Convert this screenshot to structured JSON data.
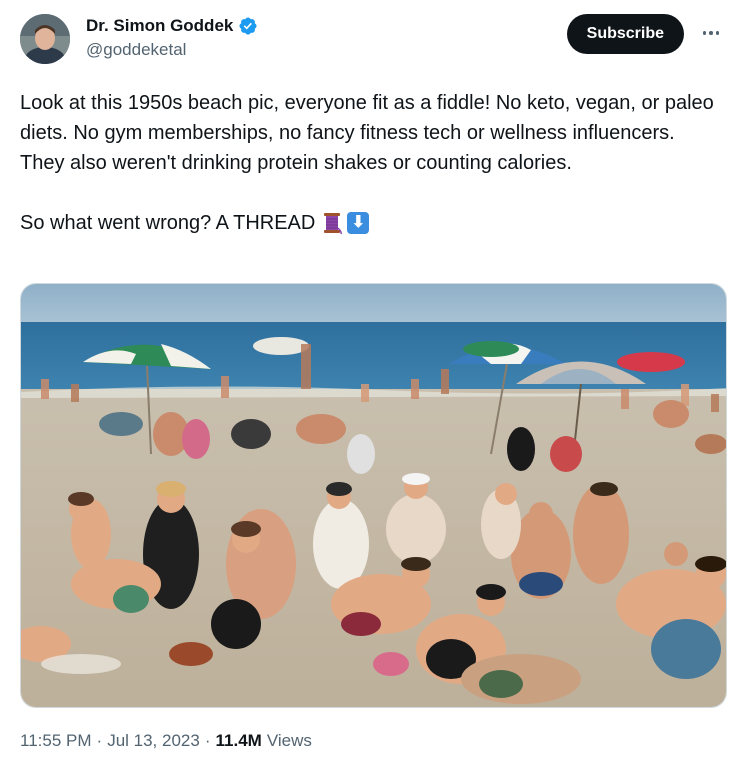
{
  "author": {
    "display_name": "Dr. Simon Goddek",
    "handle": "@goddeketal",
    "verified": true,
    "verified_color": "#1d9bf0"
  },
  "actions": {
    "subscribe_label": "Subscribe",
    "more_icon": "more-horizontal-icon"
  },
  "post": {
    "paragraph1": "Look at this 1950s beach pic, everyone fit as a fiddle! No keto, vegan, or paleo diets. No gym memberships, no fancy fitness tech or wellness influencers. They also weren't drinking protein shakes or counting calories.",
    "paragraph2": "So what went wrong? A THREAD",
    "emojis": [
      "thread-spool-emoji",
      "down-arrow-emoji"
    ]
  },
  "media": {
    "type": "photo",
    "subject": "1950s beach scene"
  },
  "meta": {
    "time": "11:55 PM",
    "separator": "·",
    "date": "Jul 13, 2023",
    "views_count": "11.4M",
    "views_label": "Views"
  }
}
